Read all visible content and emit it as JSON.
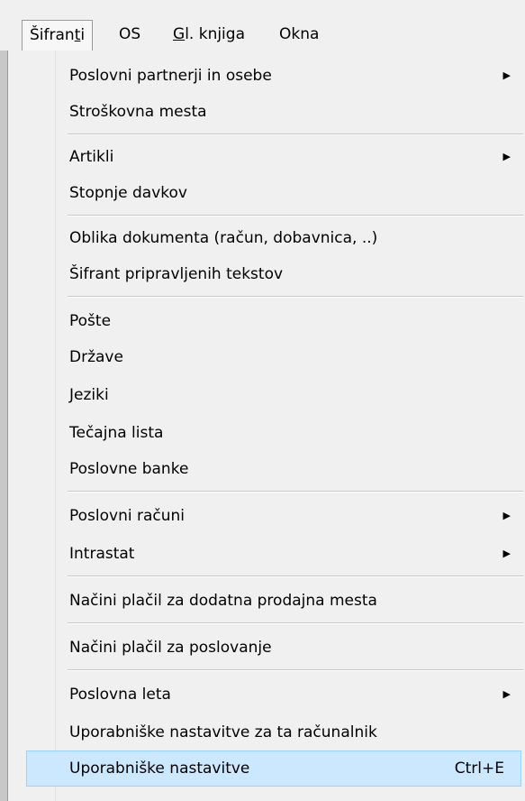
{
  "menubar": [
    {
      "label_pre": "Šifran",
      "label_u": "t",
      "label_post": "i"
    },
    {
      "label": "OS"
    },
    {
      "label_u": "G",
      "label_post": "l. knjiga"
    },
    {
      "label": "Okna"
    }
  ],
  "items": [
    {
      "label": "Poslovni partnerji in osebe",
      "submenu": true
    },
    {
      "label": "Stroškovna mesta"
    },
    {
      "label": "Artikli",
      "submenu": true
    },
    {
      "label": "Stopnje davkov"
    },
    {
      "label": "Oblika dokumenta (račun, dobavnica, ..)"
    },
    {
      "label": "Šifrant pripravljenih tekstov"
    },
    {
      "label": "Pošte"
    },
    {
      "label": "Države"
    },
    {
      "label": "Jeziki"
    },
    {
      "label": "Tečajna lista"
    },
    {
      "label": "Poslovne banke"
    },
    {
      "label": "Poslovni računi",
      "submenu": true
    },
    {
      "label": "Intrastat",
      "submenu": true
    },
    {
      "label": "Načini plačil za dodatna prodajna mesta"
    },
    {
      "label": "Načini plačil za poslovanje"
    },
    {
      "label": "Poslovna leta",
      "submenu": true
    },
    {
      "label": "Uporabniške nastavitve za ta računalnik"
    },
    {
      "label": "Uporabniške nastavitve",
      "shortcut": "Ctrl+E",
      "highlighted": true
    }
  ],
  "icons": {
    "submenu_arrow": "triangle-right-icon",
    "arrow_glyph": "▶"
  },
  "colors": {
    "highlight_bg": "#cce8ff",
    "highlight_border": "#99d1ff",
    "menu_bg": "#f0f0f0"
  }
}
